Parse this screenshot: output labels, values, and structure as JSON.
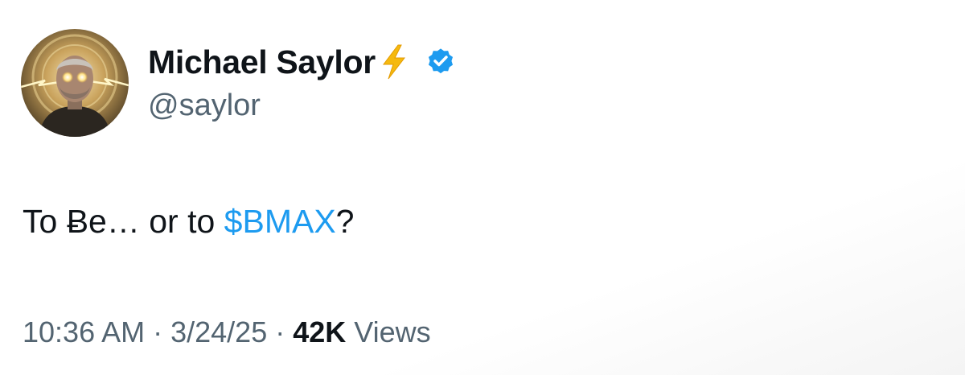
{
  "author": {
    "display_name": "Michael Saylor",
    "handle": "@saylor",
    "name_emoji": "lightning-icon",
    "verified_badge": "verified-icon"
  },
  "tweet": {
    "text_before": "To Ƀe… or to ",
    "cashtag": "$BMAX",
    "text_after": "?"
  },
  "meta": {
    "time": "10:36 AM",
    "separator": "·",
    "date": "3/24/25",
    "views_count": "42K",
    "views_label": "Views"
  },
  "colors": {
    "text_primary": "#0f1419",
    "text_secondary": "#536471",
    "accent": "#1d9bf0",
    "lightning": "#f5b90f"
  }
}
